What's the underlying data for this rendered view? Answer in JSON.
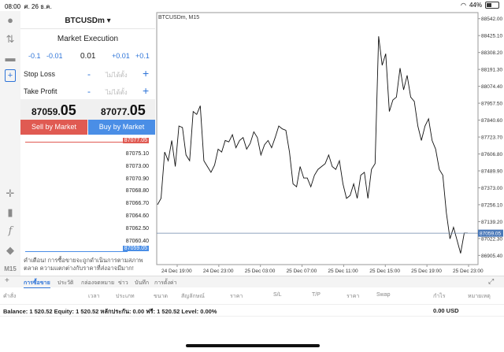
{
  "status": {
    "time": "08:00",
    "date": "ศ. 26 ธ.ค.",
    "battery": "44%"
  },
  "panel": {
    "symbol": "BTCUSDm ▾",
    "execution": "Market Execution",
    "lots": [
      "-0.1",
      "-0.01",
      "0.01",
      "+0.01",
      "+0.1"
    ],
    "stop_loss": "Stop Loss",
    "take_profit": "Take Profit",
    "placeholder": "ไม่ได้ตั้ง",
    "minus": "-",
    "plus": "+",
    "bid_main": "87059.",
    "bid_big": "05",
    "ask_main": "87077.",
    "ask_big": "05",
    "sell_label": "Sell by Market",
    "buy_label": "Buy by Market",
    "depth_top": "87077.05",
    "depth_bottom": "87059.05",
    "depth_levels": [
      "87075.10",
      "87073.00",
      "87070.90",
      "87068.80",
      "87066.70",
      "87064.60",
      "87062.50",
      "87060.40"
    ],
    "warning": "คำเตือน! การซื้อขายจะถูกดำเนินการตามสภาพตลาด ความแตกต่างกับราคาที่ส่งอาจมีมาก!"
  },
  "chart_title": "BTCUSDm, M15",
  "chart_data": {
    "type": "line",
    "y_ticks": [
      "88542.00",
      "88425.10",
      "88308.20",
      "88191.30",
      "88074.40",
      "87957.50",
      "87840.60",
      "87723.70",
      "87606.80",
      "87489.90",
      "87373.00",
      "87256.10",
      "87139.20",
      "87022.30",
      "86905.40"
    ],
    "y_tick_values": [
      88542.0,
      88425.1,
      88308.2,
      88191.3,
      88074.4,
      87957.5,
      87840.6,
      87723.7,
      87606.8,
      87489.9,
      87373.0,
      87256.1,
      87139.2,
      87022.3,
      86905.4
    ],
    "x_ticks": [
      "24 Dec 19:00",
      "24 Dec 23:00",
      "25 Dec 03:00",
      "25 Dec 07:00",
      "25 Dec 11:00",
      "25 Dec 15:00",
      "25 Dec 19:00",
      "25 Dec 23:00"
    ],
    "ylim": [
      86842.0,
      88584.0
    ],
    "current_price": 87059.05,
    "current_price_label": "87059.05",
    "values": [
      87256,
      87300,
      87620,
      87560,
      87700,
      87520,
      87800,
      87790,
      87600,
      87560,
      87900,
      87880,
      87940,
      87560,
      87520,
      87480,
      87530,
      87640,
      87620,
      87700,
      87690,
      87740,
      87650,
      87700,
      87720,
      87640,
      87680,
      87760,
      87720,
      87600,
      87670,
      87700,
      87650,
      87720,
      87800,
      87780,
      87770,
      87620,
      87400,
      87380,
      87520,
      87440,
      87440,
      87380,
      87460,
      87500,
      87520,
      87540,
      87600,
      87520,
      87500,
      87560,
      87400,
      87300,
      87320,
      87400,
      87300,
      87460,
      87480,
      87300,
      87500,
      87540,
      88420,
      88220,
      88300,
      87900,
      87980,
      88000,
      88200,
      88050,
      88150,
      88000,
      87970,
      87800,
      87700,
      87800,
      87850,
      87700,
      87640,
      87500,
      87460,
      87200,
      87020,
      87100,
      87010,
      86920,
      87060,
      87059
    ]
  },
  "tabs": [
    "การซื้อขาย",
    "ประวัติ",
    "กล่องจดหมาย",
    "ข่าว",
    "บันทึก",
    "การตั้งค่า"
  ],
  "columns": [
    "คำสั่ง",
    "เวลา",
    "ประเภท",
    "ขนาด",
    "สัญลักษณ์",
    "ราคา",
    "S/L",
    "T/P",
    "ราคา",
    "Swap",
    "กำไร",
    "หมายเหตุ"
  ],
  "balance": {
    "text": "Balance: 1 520.52 Equity: 1 520.52 หลักประกัน: 0.00 ฟรี: 1 520.52 Level: 0.00%",
    "profit": "0.00  USD"
  },
  "colors": {
    "sell": "#e05a52",
    "buy": "#4a8ee6",
    "accent": "#2e74d8"
  }
}
